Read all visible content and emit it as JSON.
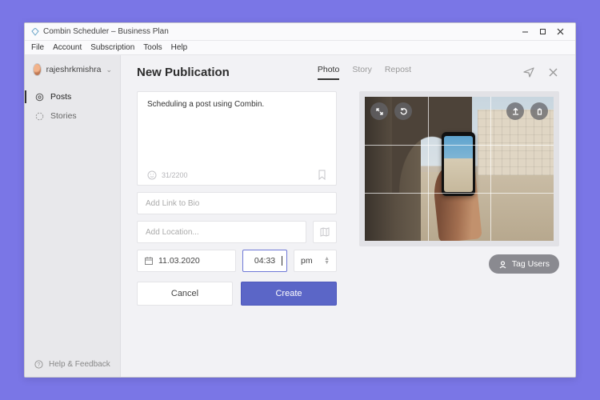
{
  "window": {
    "title": "Combin Scheduler  –  Business Plan"
  },
  "menu": {
    "file": "File",
    "account": "Account",
    "subscription": "Subscription",
    "tools": "Tools",
    "help": "Help"
  },
  "sidebar": {
    "username": "rajeshrkmishra",
    "items": [
      {
        "label": "Posts"
      },
      {
        "label": "Stories"
      }
    ],
    "help": "Help & Feedback"
  },
  "header": {
    "title": "New Publication",
    "tabs": {
      "photo": "Photo",
      "story": "Story",
      "repost": "Repost"
    }
  },
  "form": {
    "caption": "Scheduling a post using Combin.",
    "char_count": "31/2200",
    "link_placeholder": "Add Link to Bio",
    "location_placeholder": "Add Location...",
    "date": "11.03.2020",
    "time": "04:33",
    "ampm": "pm",
    "cancel": "Cancel",
    "create": "Create"
  },
  "preview": {
    "tag_users": "Tag Users"
  }
}
